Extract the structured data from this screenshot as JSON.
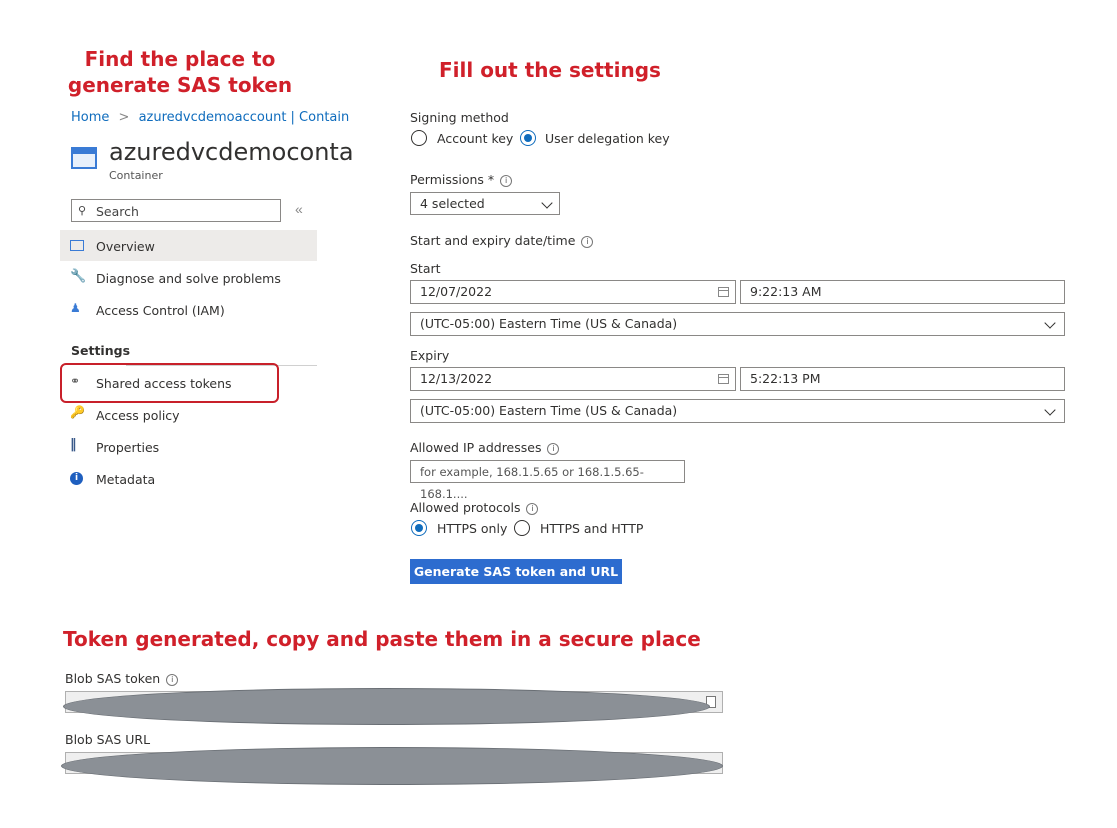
{
  "annotations": {
    "left_title_line1": "Find the place to",
    "left_title_line2": "generate SAS token",
    "right_title": "Fill out the settings",
    "bottom_title": "Token generated, copy and paste them in a secure place"
  },
  "breadcrumb": {
    "home": "Home",
    "separator": ">",
    "account": "azuredvcdemoaccount | Contain"
  },
  "resource": {
    "name": "azuredvcdemoconta",
    "type": "Container"
  },
  "search": {
    "placeholder": "Search",
    "collapse": "«"
  },
  "sidebar": {
    "items": [
      {
        "label": "Overview",
        "icon": "overview-icon"
      },
      {
        "label": "Diagnose and solve problems",
        "icon": "wrench-icon"
      },
      {
        "label": "Access Control (IAM)",
        "icon": "people-icon"
      }
    ],
    "settings_header": "Settings",
    "settings_items": [
      {
        "label": "Shared access tokens",
        "icon": "link-icon"
      },
      {
        "label": "Access policy",
        "icon": "key-icon"
      },
      {
        "label": "Properties",
        "icon": "properties-icon"
      },
      {
        "label": "Metadata",
        "icon": "info-icon"
      }
    ]
  },
  "form": {
    "signing_method_label": "Signing method",
    "signing_options": [
      "Account key",
      "User delegation key"
    ],
    "signing_selected": "User delegation key",
    "permissions_label": "Permissions *",
    "permissions_value": "4 selected",
    "date_section_label": "Start and expiry date/time",
    "start_label": "Start",
    "start_date": "12/07/2022",
    "start_time": "9:22:13 AM",
    "start_timezone": "(UTC-05:00) Eastern Time (US & Canada)",
    "expiry_label": "Expiry",
    "expiry_date": "12/13/2022",
    "expiry_time": "5:22:13 PM",
    "expiry_timezone": "(UTC-05:00) Eastern Time (US & Canada)",
    "ip_label": "Allowed IP addresses",
    "ip_placeholder": "for example, 168.1.5.65 or 168.1.5.65-168.1....",
    "protocols_label": "Allowed protocols",
    "protocol_options": [
      "HTTPS only",
      "HTTPS and HTTP"
    ],
    "protocol_selected": "HTTPS only",
    "generate_button": "Generate SAS token and URL"
  },
  "output": {
    "token_label": "Blob SAS token",
    "url_label": "Blob SAS URL"
  },
  "colors": {
    "accent": "#0f6cbd",
    "annotation_red": "#d0202a",
    "button": "#2d6ccf",
    "highlight_box": "#c8202a",
    "redaction": "#8b9096"
  }
}
